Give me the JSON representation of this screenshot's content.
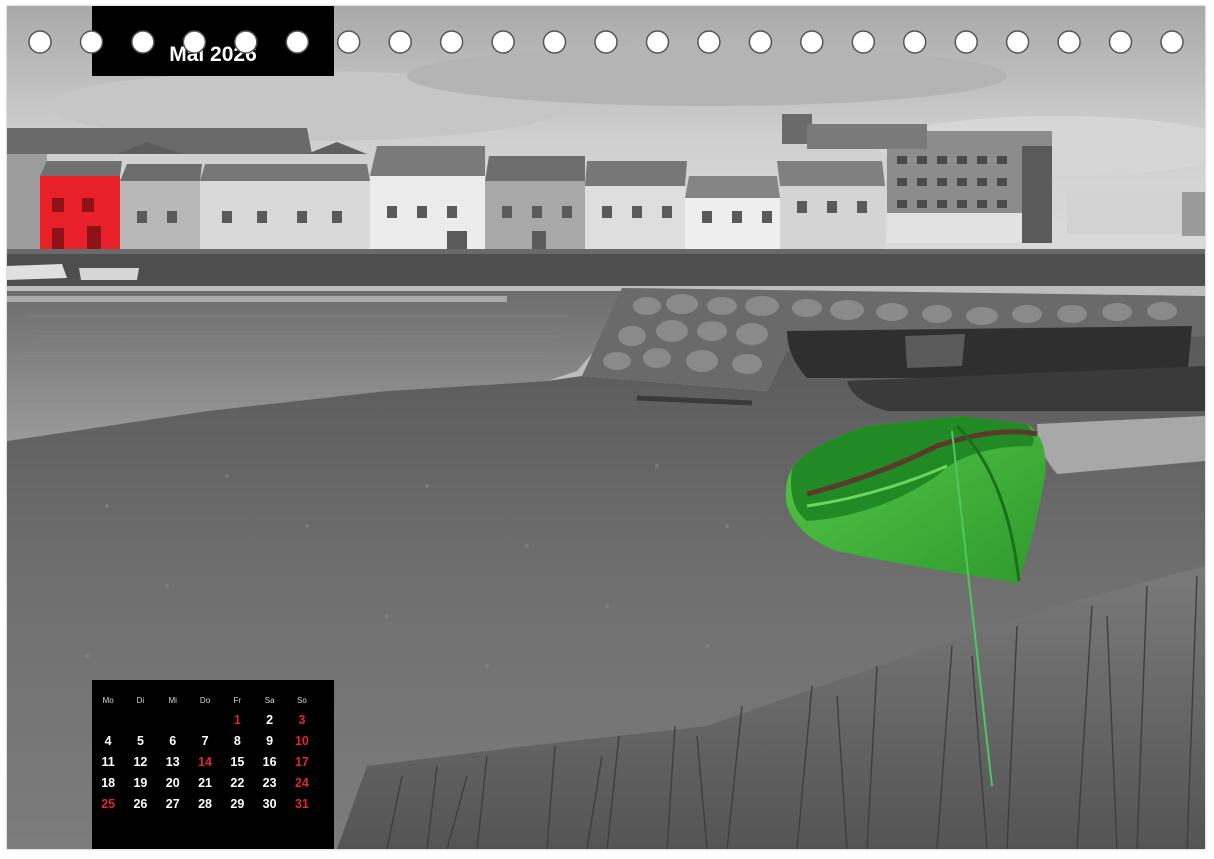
{
  "calendar": {
    "month_title": "Mai 2026",
    "weekdays": [
      "Mo",
      "Di",
      "Mi",
      "Do",
      "Fr",
      "Sa",
      "So"
    ],
    "weeks": [
      [
        "",
        "",
        "",
        "",
        "1",
        "2",
        "3"
      ],
      [
        "4",
        "5",
        "6",
        "7",
        "8",
        "9",
        "10"
      ],
      [
        "11",
        "12",
        "13",
        "14",
        "15",
        "16",
        "17"
      ],
      [
        "18",
        "19",
        "20",
        "21",
        "22",
        "23",
        "24"
      ],
      [
        "25",
        "26",
        "27",
        "28",
        "29",
        "30",
        "31"
      ]
    ],
    "highlighted_days": [
      "1",
      "3",
      "10",
      "14",
      "17",
      "24",
      "25",
      "31"
    ],
    "sunday_color": "#e2262e"
  },
  "photo": {
    "accent_boat_color": "#3db33a",
    "accent_house_color": "#e8202a"
  },
  "binding": {
    "ring_hole_count": 23
  }
}
